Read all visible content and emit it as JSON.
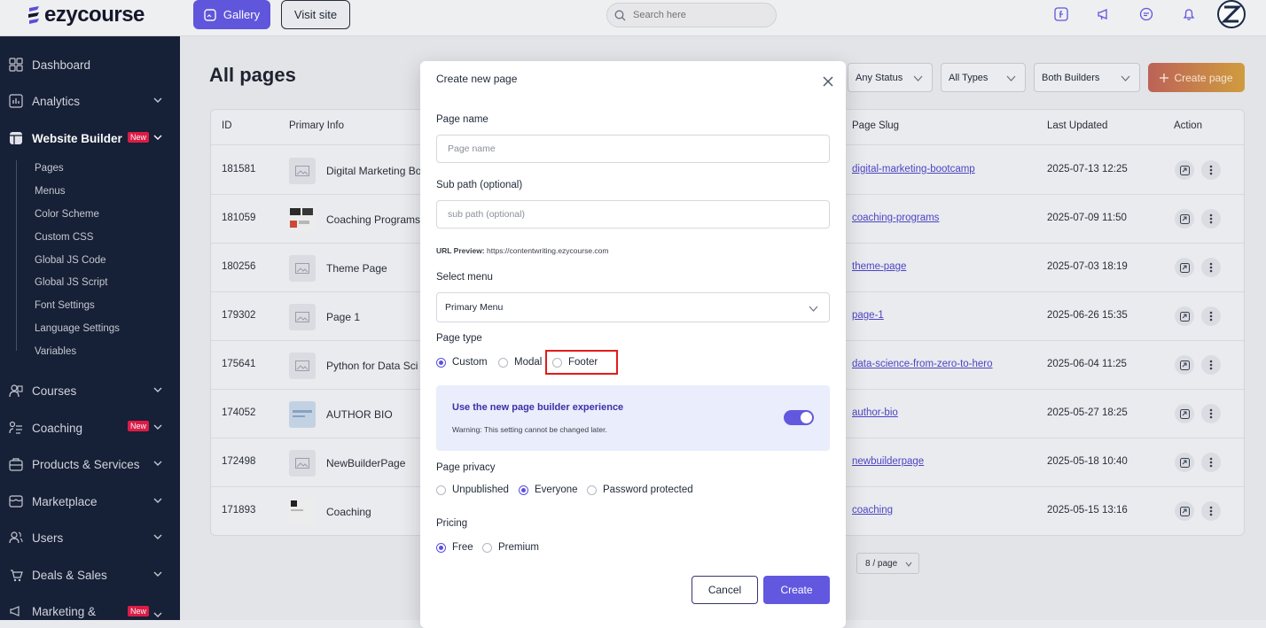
{
  "brand": {
    "name": "ezycourse"
  },
  "topbar": {
    "gallery_label": "Gallery",
    "visit_label": "Visit site",
    "search_placeholder": "Search here"
  },
  "sidebar": {
    "items": [
      {
        "label": "Dashboard",
        "icon": "dashboard-icon"
      },
      {
        "label": "Analytics",
        "icon": "analytics-icon"
      },
      {
        "label": "Website Builder",
        "icon": "website-icon",
        "badge": "New"
      },
      {
        "label": "Courses",
        "icon": "courses-icon"
      },
      {
        "label": "Coaching",
        "icon": "coaching-icon",
        "badge": "New"
      },
      {
        "label": "Products & Services",
        "icon": "products-icon"
      },
      {
        "label": "Marketplace",
        "icon": "marketplace-icon"
      },
      {
        "label": "Users",
        "icon": "users-icon"
      },
      {
        "label": "Deals & Sales",
        "icon": "deals-icon"
      },
      {
        "label": "Marketing &",
        "icon": "marketing-icon",
        "badge": "New"
      }
    ],
    "subitems": [
      "Pages",
      "Menus",
      "Color Scheme",
      "Custom CSS",
      "Global JS Code",
      "Global JS Script",
      "Font Settings",
      "Language Settings",
      "Variables"
    ]
  },
  "main": {
    "title": "All pages",
    "filters": [
      "Any Status",
      "All Types",
      "Both Builders"
    ],
    "create_page_label": "Create page",
    "columns": [
      "ID",
      "Primary Info",
      "Page Slug",
      "Last Updated",
      "Action"
    ],
    "rows": [
      {
        "id": "181581",
        "name": "Digital Marketing Bo",
        "slug": "digital-marketing-bootcamp",
        "updated": "2025-07-13 12:25"
      },
      {
        "id": "181059",
        "name": "Coaching Programs",
        "slug": "coaching-programs",
        "updated": "2025-07-09 11:50"
      },
      {
        "id": "180256",
        "name": "Theme Page",
        "slug": "theme-page",
        "updated": "2025-07-03 18:19"
      },
      {
        "id": "179302",
        "name": "Page 1",
        "slug": "page-1",
        "updated": "2025-06-26 15:35"
      },
      {
        "id": "175641",
        "name": "Python for Data Sci",
        "slug": "data-science-from-zero-to-hero",
        "updated": "2025-06-04 11:25"
      },
      {
        "id": "174052",
        "name": "AUTHOR BIO",
        "slug": "author-bio",
        "updated": "2025-05-27 18:25"
      },
      {
        "id": "172498",
        "name": "NewBuilderPage",
        "slug": "newbuilderpage",
        "updated": "2025-05-18 10:40"
      },
      {
        "id": "171893",
        "name": "Coaching",
        "slug": "coaching",
        "updated": "2025-05-15 13:16"
      }
    ],
    "pager": "8 / page"
  },
  "modal": {
    "title": "Create new page",
    "page_name_label": "Page name",
    "page_name_placeholder": "Page name",
    "sub_path_label": "Sub path (optional)",
    "sub_path_placeholder": "sub path (optional)",
    "url_preview_label": "URL Preview:",
    "url_preview_value": "https://contentwriting.ezycourse.com",
    "select_menu_label": "Select menu",
    "select_menu_value": "Primary Menu",
    "page_type_label": "Page type",
    "page_types": [
      "Custom",
      "Modal",
      "Footer"
    ],
    "page_type_selected": "Custom",
    "builder_title": "Use the new page builder experience",
    "builder_warning": "Warning: This setting cannot be changed later.",
    "builder_enabled": true,
    "privacy_label": "Page privacy",
    "privacy_options": [
      "Unpublished",
      "Everyone",
      "Password protected"
    ],
    "privacy_selected": "Everyone",
    "pricing_label": "Pricing",
    "pricing_options": [
      "Free",
      "Premium"
    ],
    "pricing_selected": "Free",
    "cancel_label": "Cancel",
    "create_label": "Create"
  },
  "colors": {
    "accent": "#6258e0",
    "sidebar_bg": "#172138",
    "highlight": "#e21b1b",
    "link": "#4f46c8"
  }
}
